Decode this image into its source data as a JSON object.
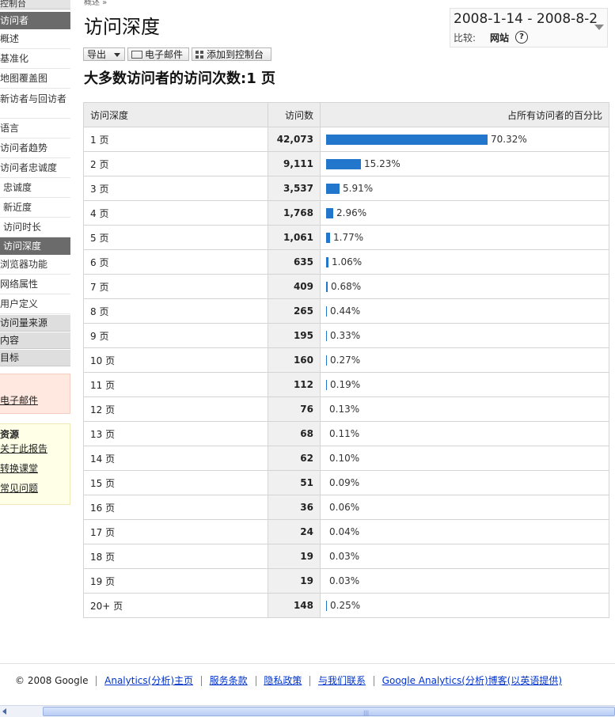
{
  "sidebar": {
    "top_label": "控制台",
    "section_visitors": "访问者",
    "items": [
      {
        "label": "概述"
      },
      {
        "label": "基准化"
      },
      {
        "label": "地图覆盖图"
      },
      {
        "label": "新访者与回访者"
      },
      {
        "label": "语言"
      },
      {
        "label": "访问者趋势"
      },
      {
        "label": "访问者忠诚度"
      },
      {
        "label": "忠诚度"
      },
      {
        "label": "新近度"
      },
      {
        "label": "访问时长"
      },
      {
        "label": "访问深度"
      },
      {
        "label": "浏览器功能"
      },
      {
        "label": "网络属性"
      },
      {
        "label": "用户定义"
      }
    ],
    "sections": [
      {
        "label": "访问量来源"
      },
      {
        "label": "内容"
      },
      {
        "label": "目标"
      }
    ],
    "email_link": "电子邮件",
    "resources_title": "资源",
    "resources": [
      {
        "label": "关于此报告"
      },
      {
        "label": "转换课堂"
      },
      {
        "label": "常见问题"
      }
    ]
  },
  "header": {
    "crumb": "概述 »",
    "title": "访问深度",
    "date_range": "2008-1-14 - 2008-8-2",
    "compare_label": "比较:",
    "compare_value": "网站",
    "help": "?"
  },
  "toolbar": {
    "export_label": "导出",
    "email_label": "电子邮件",
    "dashboard_label": "添加到控制台"
  },
  "summary": "大多数访问者的访问次数:1 页",
  "table": {
    "columns": [
      "访问深度",
      "访问数",
      "占所有访问者的百分比"
    ],
    "rows": [
      {
        "depth": "1 页",
        "visits": "42,073",
        "pct_label": "70.32%",
        "pct": 70.32
      },
      {
        "depth": "2 页",
        "visits": "9,111",
        "pct_label": "15.23%",
        "pct": 15.23
      },
      {
        "depth": "3 页",
        "visits": "3,537",
        "pct_label": "5.91%",
        "pct": 5.91
      },
      {
        "depth": "4 页",
        "visits": "1,768",
        "pct_label": "2.96%",
        "pct": 2.96
      },
      {
        "depth": "5 页",
        "visits": "1,061",
        "pct_label": "1.77%",
        "pct": 1.77
      },
      {
        "depth": "6 页",
        "visits": "635",
        "pct_label": "1.06%",
        "pct": 1.06
      },
      {
        "depth": "7 页",
        "visits": "409",
        "pct_label": "0.68%",
        "pct": 0.68
      },
      {
        "depth": "8 页",
        "visits": "265",
        "pct_label": "0.44%",
        "pct": 0.44
      },
      {
        "depth": "9 页",
        "visits": "195",
        "pct_label": "0.33%",
        "pct": 0.33
      },
      {
        "depth": "10 页",
        "visits": "160",
        "pct_label": "0.27%",
        "pct": 0.27
      },
      {
        "depth": "11 页",
        "visits": "112",
        "pct_label": "0.19%",
        "pct": 0.19
      },
      {
        "depth": "12 页",
        "visits": "76",
        "pct_label": "0.13%",
        "pct": 0.13
      },
      {
        "depth": "13 页",
        "visits": "68",
        "pct_label": "0.11%",
        "pct": 0.11
      },
      {
        "depth": "14 页",
        "visits": "62",
        "pct_label": "0.10%",
        "pct": 0.1
      },
      {
        "depth": "15 页",
        "visits": "51",
        "pct_label": "0.09%",
        "pct": 0.09
      },
      {
        "depth": "16 页",
        "visits": "36",
        "pct_label": "0.06%",
        "pct": 0.06
      },
      {
        "depth": "17 页",
        "visits": "24",
        "pct_label": "0.04%",
        "pct": 0.04
      },
      {
        "depth": "18 页",
        "visits": "19",
        "pct_label": "0.03%",
        "pct": 0.03
      },
      {
        "depth": "19 页",
        "visits": "19",
        "pct_label": "0.03%",
        "pct": 0.03
      },
      {
        "depth": "20+ 页",
        "visits": "148",
        "pct_label": "0.25%",
        "pct": 0.25
      }
    ]
  },
  "footer": {
    "copyright": "© 2008 Google",
    "links": [
      {
        "label": "Analytics(分析)主页"
      },
      {
        "label": "服务条款"
      },
      {
        "label": "隐私政策"
      },
      {
        "label": "与我们联系"
      },
      {
        "label": "Google Analytics(分析)博客(以英语提供)"
      }
    ]
  },
  "colors": {
    "bar": "#2277cc",
    "active_nav": "#6b6b6b",
    "link": "#0033cc"
  }
}
